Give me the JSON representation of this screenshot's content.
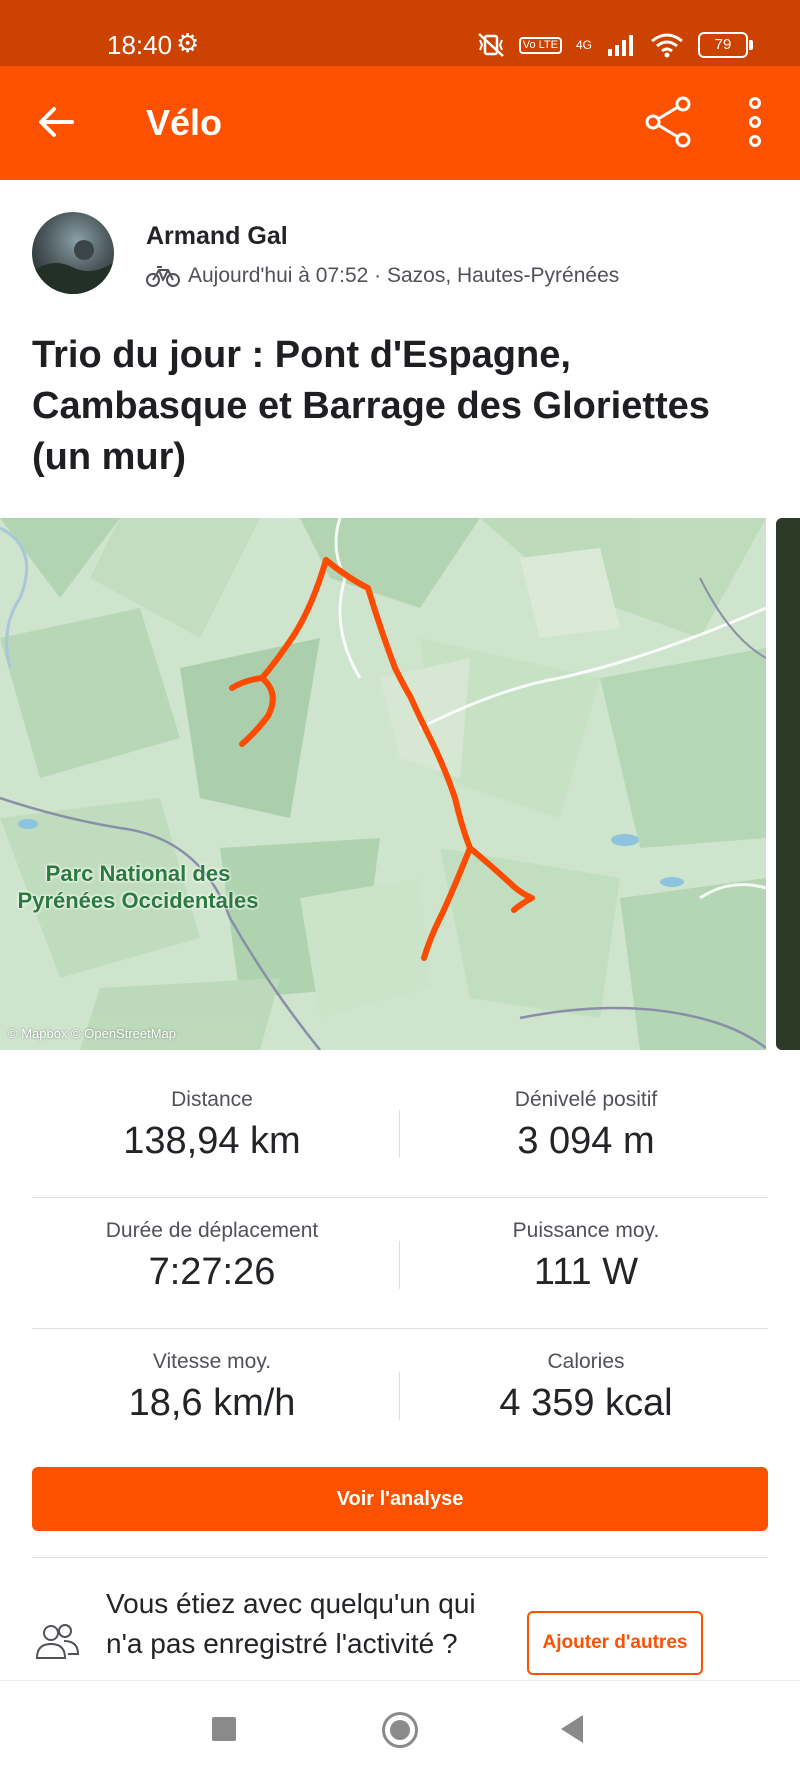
{
  "status_bar": {
    "time": "18:40",
    "network": "4G",
    "volte_badge": "Vo LTE",
    "battery": "79"
  },
  "app_bar": {
    "title": "Vélo",
    "icons": [
      "back-arrow-icon",
      "share-icon",
      "more-vertical-icon"
    ]
  },
  "activity": {
    "athlete": "Armand Gal",
    "meta": "Aujourd'hui à 07:52 · Sazos, Hautes-Pyrénées",
    "sport_icon": "bike-icon",
    "title": "Trio du jour : Pont d'Espagne, Cambasque et Barrage des Gloriettes (un mur)"
  },
  "map": {
    "label": "Parc National des Pyrénées Occidentales",
    "attribution": "© Mapbox © OpenStreetMap",
    "route_color": "#fc4c02"
  },
  "stats": [
    {
      "label": "Distance",
      "value": "138,94 km"
    },
    {
      "label": "Dénivelé positif",
      "value": "3 094 m"
    },
    {
      "label": "Durée de déplacement",
      "value": "7:27:26"
    },
    {
      "label": "Puissance moy.",
      "value": "111 W"
    },
    {
      "label": "Vitesse moy.",
      "value": "18,6 km/h"
    },
    {
      "label": "Calories",
      "value": "4 359 kcal"
    }
  ],
  "actions": {
    "analyse_label": "Voir l'analyse"
  },
  "friends": {
    "prompt": "Vous étiez avec quelqu'un qui n'a pas enregistré l'activité ?",
    "button_label": "Ajouter d'autres amis"
  },
  "colors": {
    "brand": "#fc5200",
    "status_bar": "#cc4200"
  }
}
